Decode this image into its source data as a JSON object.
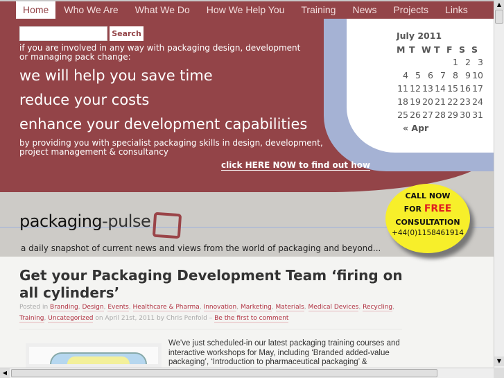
{
  "nav": [
    "Home",
    "Who We Are",
    "What We Do",
    "How We Help You",
    "Training",
    "News",
    "Projects",
    "Links"
  ],
  "search": {
    "button": "Search",
    "value": ""
  },
  "hero": {
    "intro": "if you are involved in any way with packaging design, development or managing pack change:",
    "line1": "we will help you save time",
    "line2": "reduce your costs",
    "line3": "enhance your development capabilities",
    "by": "by providing you with specialist packaging skills in design, development, project management & consultancy",
    "cta": "click HERE NOW to find out how"
  },
  "calendar": {
    "title": "July 2011",
    "days": [
      "M",
      "T",
      "W",
      "T",
      "F",
      "S",
      "S"
    ],
    "weeks": [
      [
        "",
        "",
        "",
        "",
        "1",
        "2",
        "3"
      ],
      [
        "4",
        "5",
        "6",
        "7",
        "8",
        "9",
        "10"
      ],
      [
        "11",
        "12",
        "13",
        "14",
        "15",
        "16",
        "17"
      ],
      [
        "18",
        "19",
        "20",
        "21",
        "22",
        "23",
        "24"
      ],
      [
        "25",
        "26",
        "27",
        "28",
        "29",
        "30",
        "31"
      ]
    ],
    "prev": "« Apr"
  },
  "logo": {
    "bold": "packaging",
    "light": "-pulse",
    "tagline": "a daily snapshot of current news and views from the world of packaging and beyond..."
  },
  "badge": {
    "l1": "CALL NOW",
    "for": "FOR",
    "free": "FREE",
    "l3": "CONSULTATION",
    "phone": "+44(0)1158461914"
  },
  "post": {
    "title": "Get your Packaging Development Team ‘firing on all cylinders’",
    "posted_in": "Posted in",
    "categories": [
      "Branding",
      "Design",
      "Events",
      "Healthcare & Pharma",
      "Innovation",
      "Marketing",
      "Materials",
      "Medical Devices",
      "Recycling",
      "Training",
      "Uncategorized"
    ],
    "date_by": "on April 21st, 2011 by Chris Penfold –",
    "comments": "Be the first to comment",
    "excerpt": "We've just scheduled-in our latest packaging training courses and interactive workshops for May, including ‘Branded added-value packaging’, ‘Introduction to pharmaceutical packaging’ &"
  },
  "colors": {
    "brand": "#934448",
    "accent_blue": "#a5b2d4",
    "badge": "#f7ef2a"
  }
}
